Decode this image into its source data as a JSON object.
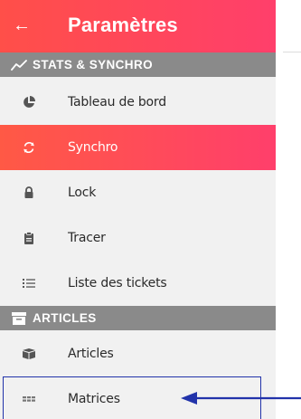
{
  "header": {
    "title": "Paramètres"
  },
  "sections": [
    {
      "label": "STATS & SYNCHRO"
    },
    {
      "label": "ARTICLES"
    }
  ],
  "items": [
    {
      "label": "Tableau de bord",
      "icon": "pie-chart-icon"
    },
    {
      "label": "Synchro",
      "icon": "sync-icon",
      "active": true
    },
    {
      "label": "Lock",
      "icon": "lock-icon"
    },
    {
      "label": "Tracer",
      "icon": "clipboard-icon"
    },
    {
      "label": "Liste des tickets",
      "icon": "list-icon"
    },
    {
      "label": "Articles",
      "icon": "box-icon"
    },
    {
      "label": "Matrices",
      "icon": "grid-icon"
    }
  ],
  "colors": {
    "header_gradient_start": "#ff4f49",
    "header_gradient_end": "#ff3f6b",
    "section_bg": "#8a8a8a",
    "drawer_bg": "#f1f1f1",
    "annotation": "#2233aa"
  }
}
